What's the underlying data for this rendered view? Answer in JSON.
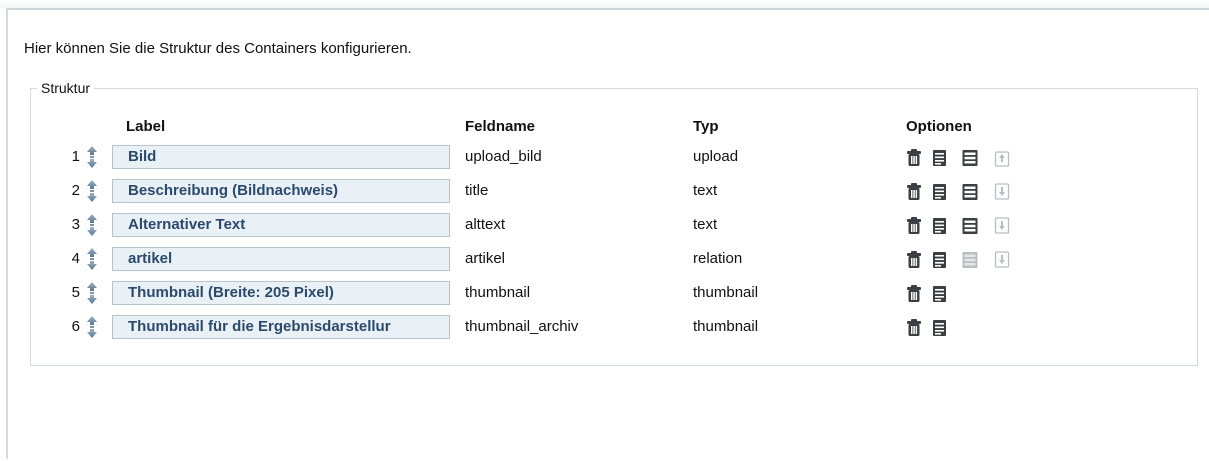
{
  "intro_text": "Hier können Sie die Struktur des Containers konfigurieren.",
  "fieldset": {
    "legend": "Struktur"
  },
  "columns": {
    "label": "Label",
    "feldname": "Feldname",
    "typ": "Typ",
    "optionen": "Optionen"
  },
  "rows": [
    {
      "num": "1",
      "label": "Bild",
      "feldname": "upload_bild",
      "typ": "upload",
      "options": [
        "delete-icon",
        "edit-icon",
        "list-icon-active",
        "upload-icon-disabled"
      ]
    },
    {
      "num": "2",
      "label": "Beschreibung (Bildnachweis)",
      "feldname": "title",
      "typ": "text",
      "options": [
        "delete-icon",
        "edit-icon",
        "list-icon-active",
        "download-icon-disabled"
      ]
    },
    {
      "num": "3",
      "label": "Alternativer Text",
      "feldname": "alttext",
      "typ": "text",
      "options": [
        "delete-icon",
        "edit-icon",
        "list-icon-active",
        "download-icon-disabled"
      ]
    },
    {
      "num": "4",
      "label": "artikel",
      "feldname": "artikel",
      "typ": "relation",
      "options": [
        "delete-icon",
        "edit-icon",
        "list-icon-disabled",
        "download-icon-disabled"
      ]
    },
    {
      "num": "5",
      "label": "Thumbnail (Breite: 205 Pixel)",
      "feldname": "thumbnail",
      "typ": "thumbnail",
      "options": [
        "delete-icon",
        "edit-icon"
      ]
    },
    {
      "num": "6",
      "label": "Thumbnail für die Ergebnisdarstellur",
      "feldname": "thumbnail_archiv",
      "typ": "thumbnail",
      "options": [
        "delete-icon",
        "edit-icon"
      ]
    }
  ],
  "colors": {
    "input_bg": "#e9f1f7",
    "input_text": "#2b4a6b",
    "icon": "#3a3f44",
    "icon_disabled": "#b9bec3"
  }
}
